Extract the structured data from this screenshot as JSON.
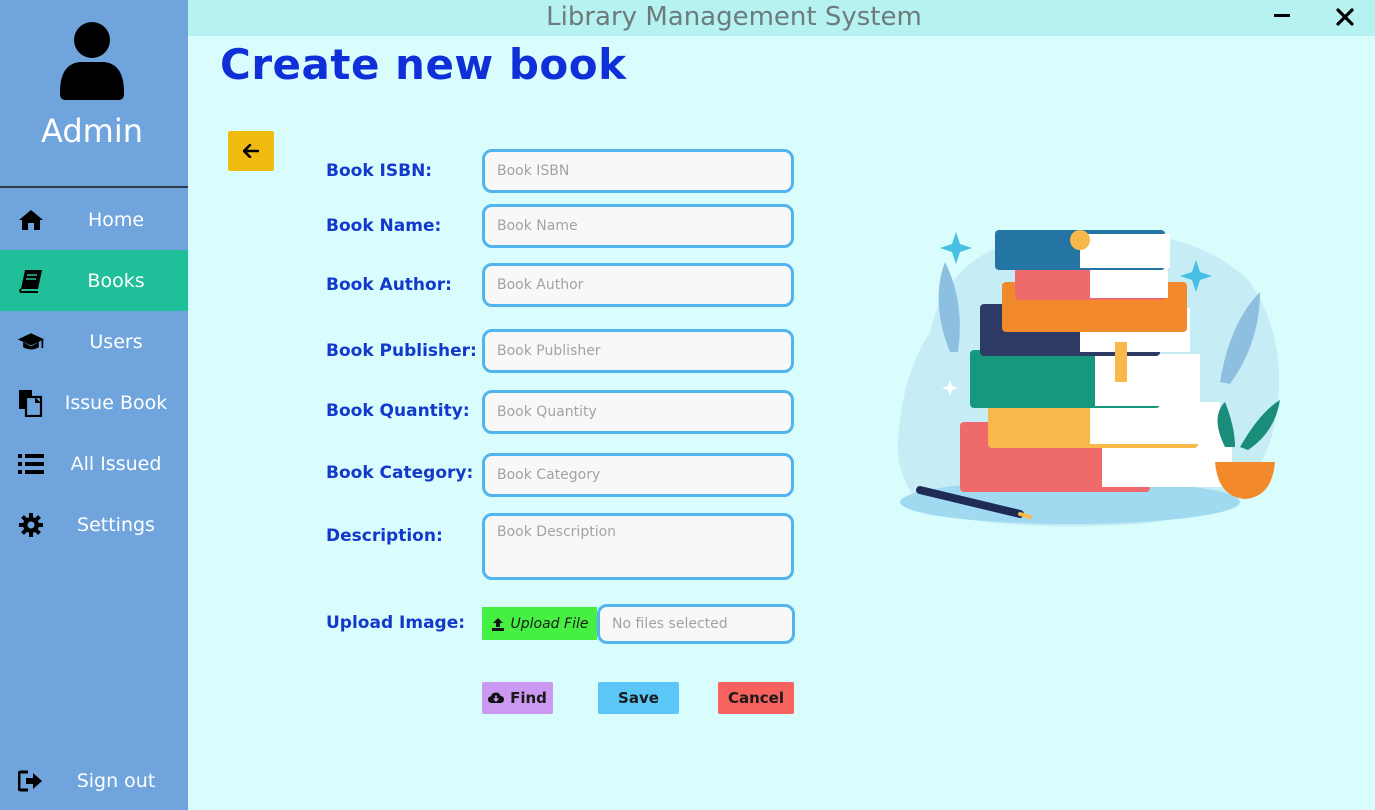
{
  "window": {
    "title": "Library Management System"
  },
  "sidebar": {
    "user_label": "Admin",
    "items": [
      {
        "label": "Home",
        "icon": "home-icon"
      },
      {
        "label": "Books",
        "icon": "book-icon",
        "active": true
      },
      {
        "label": "Users",
        "icon": "graduation-cap-icon"
      },
      {
        "label": "Issue Book",
        "icon": "copy-icon"
      },
      {
        "label": "All Issued",
        "icon": "list-icon"
      },
      {
        "label": "Settings",
        "icon": "gear-icon"
      }
    ],
    "signout_label": "Sign out"
  },
  "main": {
    "title": "Create new book",
    "fields": {
      "isbn": {
        "label": "Book ISBN:",
        "placeholder": "Book ISBN",
        "value": ""
      },
      "name": {
        "label": "Book Name:",
        "placeholder": "Book Name",
        "value": ""
      },
      "author": {
        "label": "Book Author:",
        "placeholder": "Book Author",
        "value": ""
      },
      "publisher": {
        "label": "Book Publisher:",
        "placeholder": "Book Publisher",
        "value": ""
      },
      "quantity": {
        "label": "Book Quantity:",
        "placeholder": "Book Quantity",
        "value": ""
      },
      "category": {
        "label": "Book Category:",
        "placeholder": "Book Category",
        "value": ""
      },
      "description": {
        "label": "Description:",
        "placeholder": "Book Description",
        "value": ""
      },
      "image": {
        "label": "Upload Image:",
        "button_label": "Upload File",
        "file_status": "No files selected"
      }
    },
    "actions": {
      "find_label": "Find",
      "save_label": "Save",
      "cancel_label": "Cancel"
    }
  },
  "colors": {
    "sidebar_bg": "#6fa4dc",
    "active_nav": "#1fbf99",
    "page_bg": "#d9fdfd",
    "titlebar_bg": "#b6f2f2",
    "title_blue": "#0f2fd8",
    "label_blue": "#1338cc",
    "input_border": "#52b4ee",
    "back_button": "#f0bc0f",
    "upload_button": "#45f043",
    "find_button": "#cc99f2",
    "save_button": "#5ac7f7",
    "cancel_button": "#f7625e"
  }
}
